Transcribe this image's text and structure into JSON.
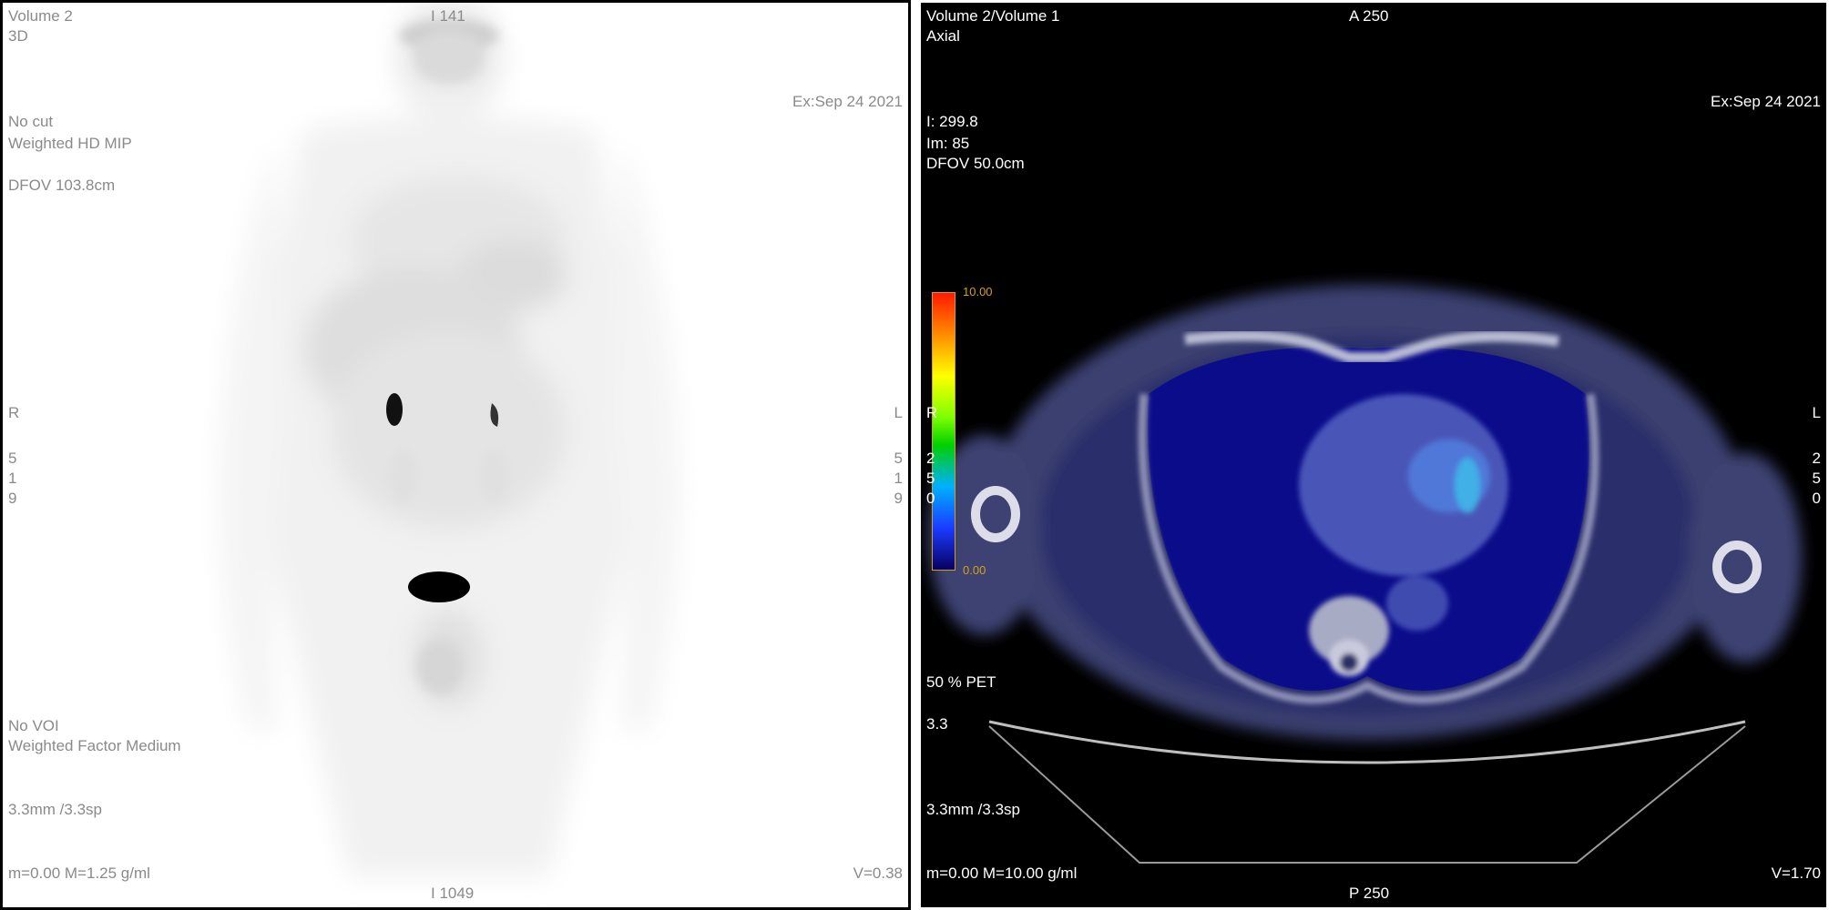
{
  "left_view": {
    "volume_label": "Volume 2",
    "mode_label": "3D",
    "top_marker": "I 141",
    "exam_date": "Ex:Sep 24 2021",
    "cut_label": "No cut",
    "render_label": "Weighted HD MIP",
    "dfov": "DFOV 103.8cm",
    "right_orient": "R",
    "left_orient": "L",
    "left_series_digits": "5\n1\n9",
    "right_series_digits": "5\n1\n9",
    "voi_label": "No VOI",
    "weight_label": "Weighted Factor Medium",
    "thickness": "3.3mm /3.3sp",
    "range_label": "m=0.00 M=1.25 g/ml",
    "volume_value": "V=0.38",
    "bottom_marker": "I 1049"
  },
  "right_view": {
    "volume_label": "Volume 2/Volume 1",
    "mode_label": "Axial",
    "top_marker": "A 250",
    "exam_date": "Ex:Sep 24 2021",
    "image_i": "I: 299.8",
    "image_im": "Im: 85",
    "dfov": "DFOV 50.0cm",
    "colorbar_max": "10.00",
    "colorbar_min": "0.00",
    "right_orient": "R",
    "left_orient": "L",
    "left_series_digits": "2\n5\n0",
    "right_series_digits": "2\n5\n0",
    "blend_label": "50 % PET",
    "thickness_short": "3.3",
    "thickness": "3.3mm /3.3sp",
    "range_label": "m=0.00 M=10.00 g/ml",
    "volume_value": "V=1.70",
    "bottom_marker": "P 250"
  }
}
